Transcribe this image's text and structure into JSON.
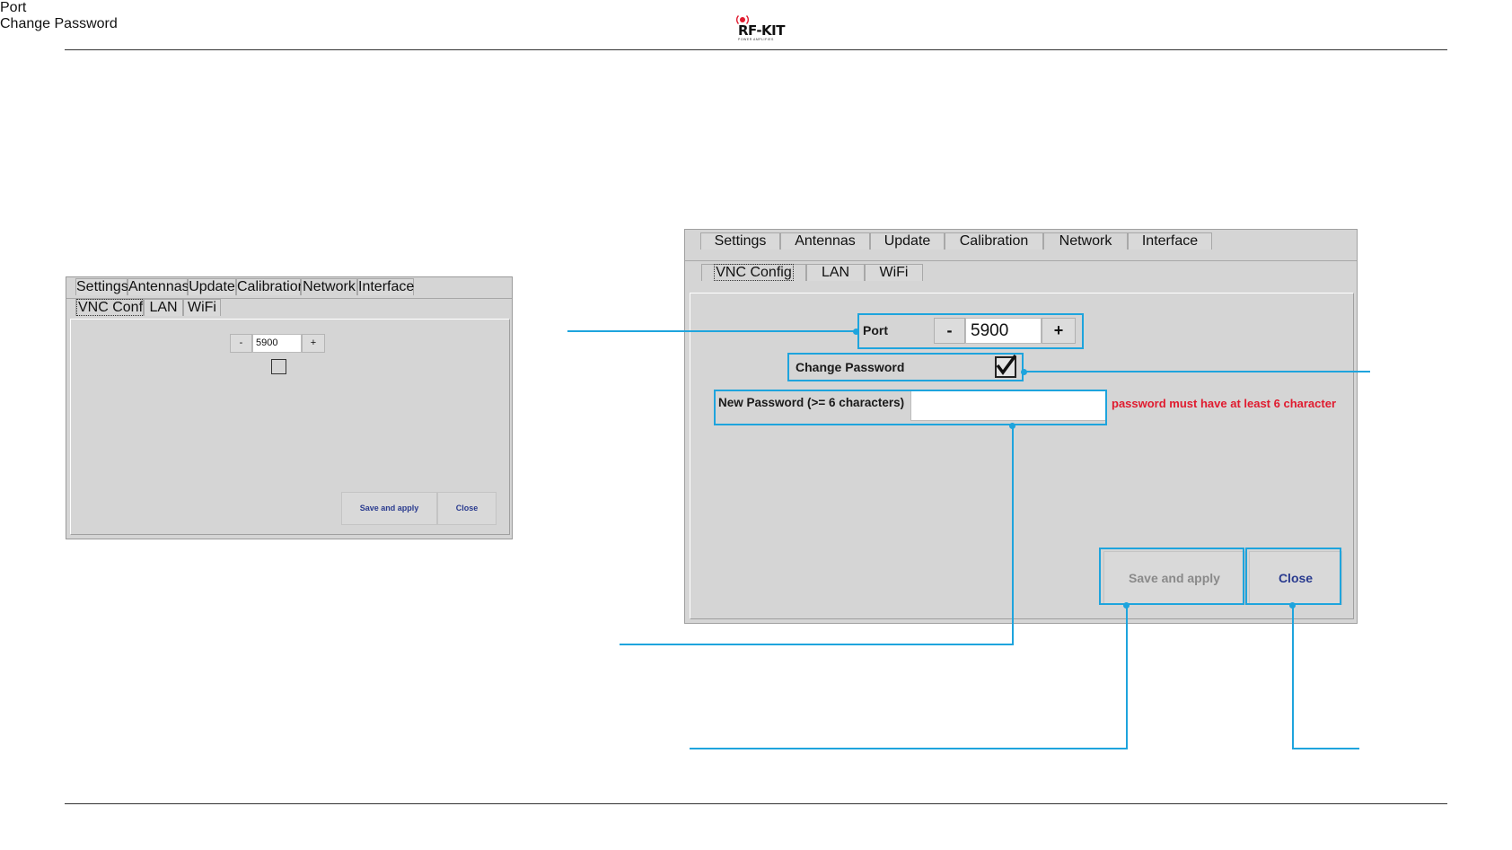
{
  "logo": {
    "text": "RF-KIT",
    "subtext": "POWER AMPLIFIES"
  },
  "tabs": [
    "Settings",
    "Antennas",
    "Update",
    "Calibration",
    "Network",
    "Interface"
  ],
  "subtabs": [
    "VNC Config",
    "LAN",
    "WiFi"
  ],
  "port": {
    "label": "Port",
    "value": "5900",
    "minus": "-",
    "plus": "+"
  },
  "change_password": {
    "label": "Change Password"
  },
  "new_password": {
    "label": "New Password (>= 6 characters)",
    "value": "",
    "error": "password must have at least 6 character"
  },
  "actions": {
    "save": "Save and apply",
    "close": "Close"
  },
  "colors": {
    "accent": "#1ea4dd",
    "error": "#e01b2f",
    "link": "#2a3b8f"
  }
}
